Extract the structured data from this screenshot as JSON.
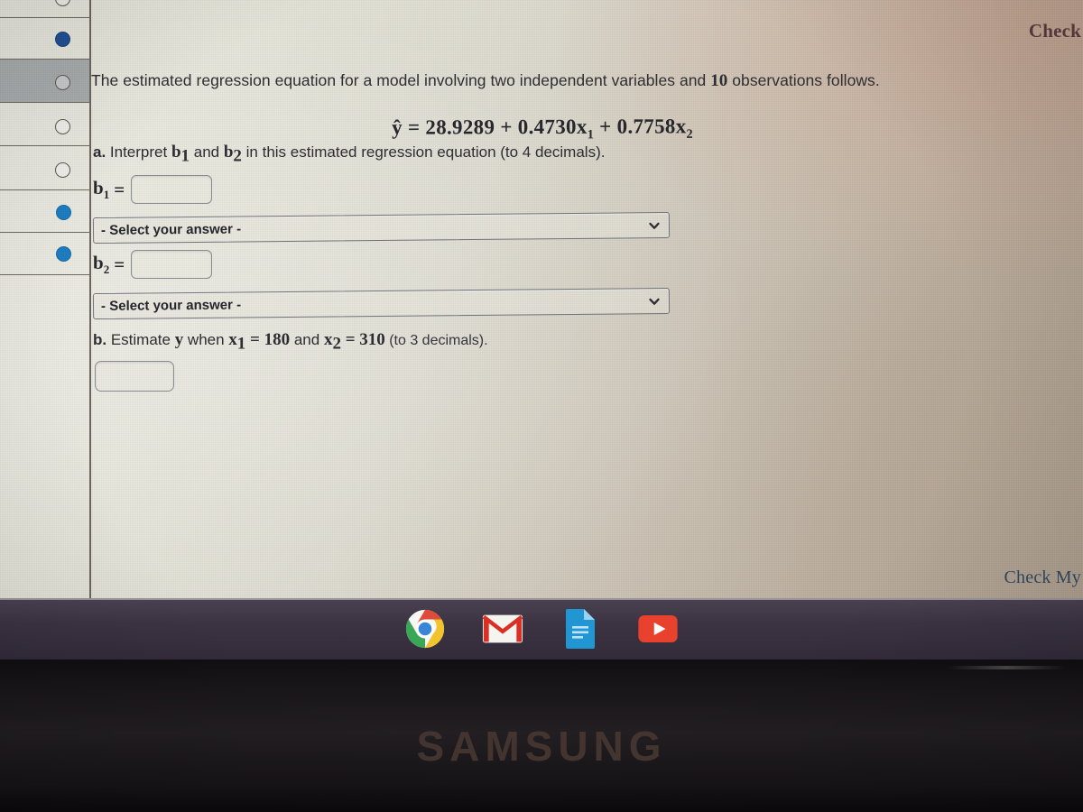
{
  "window": {
    "check_top_label": "Check",
    "check_bottom_label": "Check My"
  },
  "sidebar": {
    "rows": [
      {
        "name": "nav-item-1",
        "marker": "circle-empty",
        "selected": false
      },
      {
        "name": "nav-item-2",
        "marker": "circle-filled",
        "selected": false
      },
      {
        "name": "nav-item-3",
        "marker": "circle-empty",
        "selected": true
      },
      {
        "name": "nav-item-4",
        "marker": "circle-empty",
        "selected": false
      },
      {
        "name": "nav-item-5",
        "marker": "circle-empty",
        "selected": false
      },
      {
        "name": "nav-item-6",
        "marker": "circle-filled",
        "selected": false
      },
      {
        "name": "nav-item-7",
        "marker": "circle-filled",
        "selected": false
      }
    ]
  },
  "question": {
    "prompt_part1": "The estimated regression equation for a model involving two independent variables and ",
    "prompt_count": "10",
    "prompt_part2": " observations follows.",
    "equation": {
      "lhs": "ŷ",
      "equals": "=",
      "intercept": "28.9289",
      "plus1": "+",
      "coef1": "0.4730",
      "var1": "x",
      "var1_sub": "1",
      "plus2": "+",
      "coef2": "0.7758",
      "var2": "x",
      "var2_sub": "2"
    },
    "part_a": {
      "marker": "a.",
      "text_1": " Interpret ",
      "b1": "b",
      "b1_sub": "1",
      "text_2": " and ",
      "b2": "b",
      "b2_sub": "2",
      "text_3": " in this estimated regression equation (to 4 decimals)."
    },
    "part_b": {
      "marker": "b.",
      "text_1": " Estimate ",
      "y": "y",
      "text_2": " when ",
      "x1": "x",
      "x1_sub": "1",
      "eq1": " = ",
      "x1_value": "180",
      "text_3": " and ",
      "x2": "x",
      "x2_sub": "2",
      "eq2": " = ",
      "x2_value": "310",
      "text_4": " (to 3 decimals)."
    },
    "fields": {
      "b1_label": "b",
      "b1_label_sub": "1",
      "b1_equals": "=",
      "b1_value": "",
      "b1_placeholder": "",
      "b2_label": "b",
      "b2_label_sub": "2",
      "b2_equals": "=",
      "b2_value": "",
      "b2_placeholder": "",
      "answer_b_value": "",
      "answer_b_placeholder": ""
    },
    "selects": [
      {
        "name": "b1-interpretation-select",
        "selected": "- Select your answer -"
      },
      {
        "name": "b2-interpretation-select",
        "selected": "- Select your answer -"
      }
    ]
  },
  "taskbar": {
    "icons": [
      {
        "name": "chrome-icon",
        "label": "Chrome"
      },
      {
        "name": "gmail-icon",
        "label": "Gmail"
      },
      {
        "name": "google-docs-icon",
        "label": "Docs"
      },
      {
        "name": "youtube-icon",
        "label": "YouTube"
      }
    ]
  },
  "monitor": {
    "brand": "SAMSUNG"
  },
  "colors": {
    "page_bg": "#e2e2d8",
    "text": "#2c2c30",
    "check_top": "#5c3a3f",
    "check_bottom": "#31485f",
    "select_border": "#70747b",
    "sidebar_dot_filled": "#1f4f96",
    "taskbar_bg": "#3c3443",
    "bezel_bg": "#191619",
    "samsung_logo": "#4b3a33"
  }
}
